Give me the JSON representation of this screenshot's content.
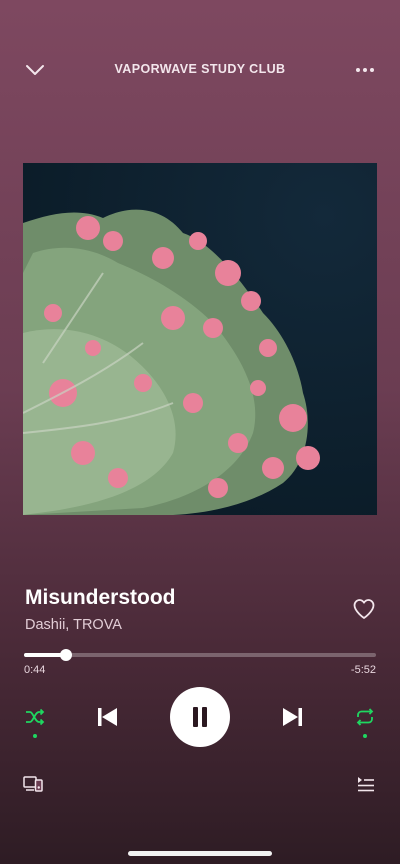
{
  "header": {
    "title": "VAPORWAVE STUDY CLUB",
    "left_icon": "chevron-down-icon",
    "right_icon": "more-horizontal-icon"
  },
  "track": {
    "title": "Misunderstood",
    "artist": "Dashii, TROVA",
    "liked": false
  },
  "playback": {
    "elapsed": "0:44",
    "remaining": "-5:52",
    "progress_fraction": 0.119,
    "is_playing": true,
    "shuffle_on": true,
    "repeat_on": true
  },
  "colors": {
    "background_top": "#7e4860",
    "background_bottom": "#2e1c24",
    "accent_green": "#1ed760",
    "text_primary": "#ffffff",
    "text_secondary": "#e2cdd6"
  },
  "icons": {
    "shuffle": "shuffle-icon",
    "previous": "skip-previous-icon",
    "play_pause": "pause-icon",
    "next": "skip-next-icon",
    "repeat": "repeat-icon",
    "devices": "devices-icon",
    "queue": "queue-icon",
    "like": "heart-icon"
  }
}
